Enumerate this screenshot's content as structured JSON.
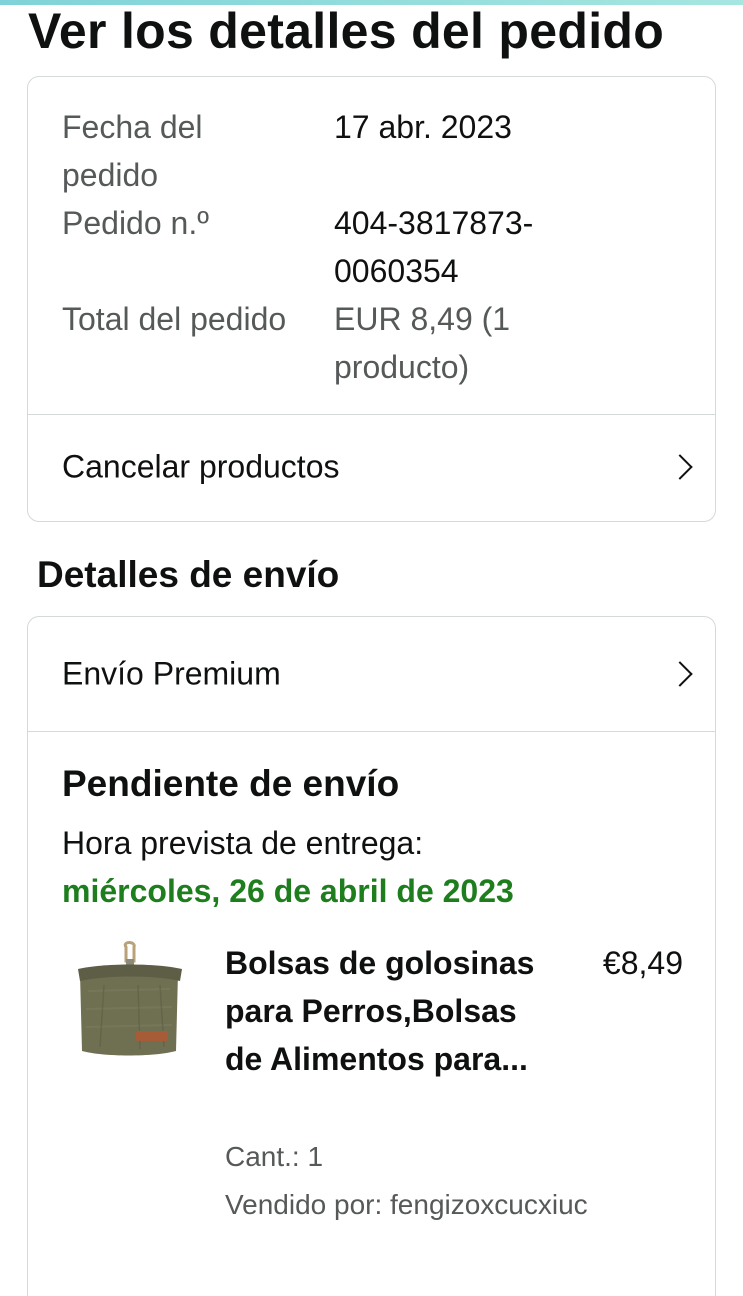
{
  "header": {
    "title": "Ver los detalles del pedido"
  },
  "order_summary": {
    "date_label": "Fecha del pedido",
    "date_value": "17 abr. 2023",
    "number_label": "Pedido n.º",
    "number_value": "404-3817873-0060354",
    "total_label": "Total del pedido",
    "total_value": "EUR 8,49 (1 producto)",
    "cancel_label": "Cancelar productos"
  },
  "shipping": {
    "section_title": "Detalles de envío",
    "method_label": "Envío Premium",
    "status": "Pendiente de envío",
    "eta_label": "Hora prevista de entrega:",
    "eta_date": "miércoles, 26 de abril de 2023",
    "eta_color": "#1e7e1e"
  },
  "item": {
    "title": "Bolsas de golosinas para Perros,Bolsas de Alimentos para...",
    "price": "€8,49",
    "quantity": "Cant.: 1",
    "seller": "Vendido por: fengizoxcucxiuc",
    "image_icon": "dog-treat-pouch-image"
  },
  "colors": {
    "border": "#d5d9d9",
    "muted_text": "#565959",
    "primary_text": "#0f1111",
    "accent_bar": "#7fd3d8"
  }
}
